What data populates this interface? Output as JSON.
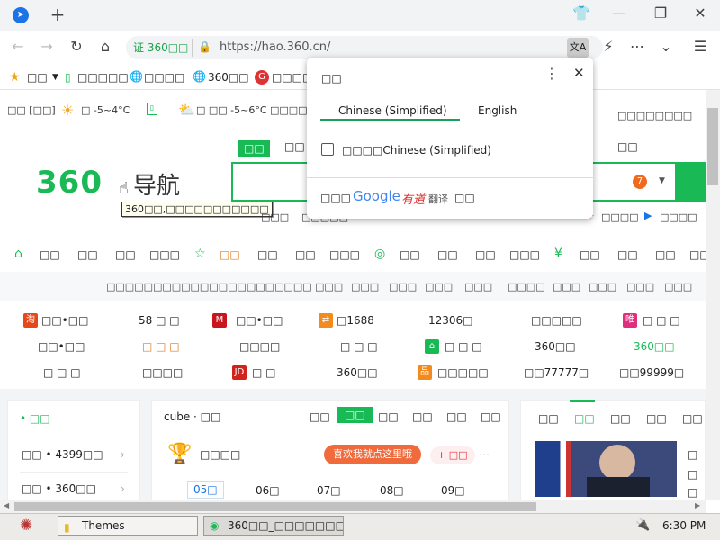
{
  "browser": {
    "tabs_icon": "compass-icon",
    "new_tab": "+",
    "url": "https://hao.360.cn/",
    "secure_chip": "证 360□□",
    "window_controls": [
      "tshirt-icon",
      "minimize-icon",
      "restore-icon",
      "close-icon"
    ],
    "toolbar_icons": [
      "translate-icon",
      "lightning-icon",
      "more-icon",
      "chevron-down-icon",
      "menu-icon"
    ]
  },
  "bookmarks": [
    {
      "icon": "star-icon",
      "label": "□□"
    },
    {
      "icon": "phone-icon",
      "label": "□□□□□"
    },
    {
      "icon": "globe-icon",
      "label": "□□□□"
    },
    {
      "icon": "globe-icon",
      "label": "360□□"
    },
    {
      "icon": "g-logo-icon",
      "label": "□□□□"
    }
  ],
  "translate_popup": {
    "title": "□□",
    "tab_source": "Chinese (Simplified)",
    "tab_target": "English",
    "checkbox_label": "□□□□Chinese (Simplified)",
    "footer_prefix": "□□□",
    "footer_brand": "Google",
    "footer_youdao": "有道",
    "footer_fanyi": "翻译",
    "footer_suffix": "□□"
  },
  "weather": {
    "city": "□□ [□□]",
    "today": "□ -5~4°C",
    "tomorrow": "□ □□ -5~6°C",
    "more": "□□□□",
    "right": "□□□□□□□□"
  },
  "logo": {
    "n360": "360",
    "dh": "导航",
    "tooltip": "360□□,□□□□□□□□□□□"
  },
  "search": {
    "tabs": [
      "□□",
      "□□",
      "□□"
    ],
    "badge": "7",
    "under_links": [
      "□□□",
      "□□□□□",
      "□□□□",
      "□□□□"
    ]
  },
  "categories": [
    {
      "icon": "home-icon",
      "items": [
        "□□",
        "□□",
        "□□",
        "□□□"
      ]
    },
    {
      "icon": "star-icon",
      "items": [
        "□□",
        "□□",
        "□□",
        "□□□"
      ]
    },
    {
      "icon": "game-icon",
      "items": [
        "□□",
        "□□",
        "□□",
        "□□□"
      ]
    },
    {
      "icon": "money-icon",
      "items": [
        "□□",
        "□□",
        "□□",
        "□□"
      ]
    }
  ],
  "sublinks": {
    "left": "□□□□□□□□□□□□□□□□□□□□□□",
    "items": [
      "□□□",
      "□□□",
      "□□□",
      "□□□",
      "□□□",
      "□□□□",
      "□□□",
      "□□□",
      "□□□",
      "□□□"
    ]
  },
  "sites": [
    [
      "□□•□□",
      "58 □ □",
      "□□•□□",
      "□1688",
      "12306□",
      "□□□□□",
      "□ □ □"
    ],
    [
      "□□•□□",
      "□ □ □",
      "□□□□",
      "□ □ □",
      "□ □ □",
      "360□□",
      "360□□"
    ],
    [
      "□ □ □",
      "□□□□",
      "□ □",
      "360□□",
      "□□□□□",
      "□□77777□",
      "□□99999□"
    ]
  ],
  "left_col": {
    "active": "□□",
    "rows": [
      "□□ • 4399□□",
      "□□ • 360□□"
    ]
  },
  "mid_col": {
    "title": "cube · □□",
    "tabs": [
      "□□",
      "□□",
      "□□",
      "□□",
      "□□",
      "□□"
    ],
    "item": "□□□□",
    "promo": "喜欢我就点这里哦",
    "add": "+ □□",
    "dates": [
      "05□",
      "06□",
      "07□",
      "08□",
      "09□"
    ]
  },
  "right_col": {
    "tabs": [
      "□□",
      "□□",
      "□□",
      "□□",
      "□□"
    ],
    "side": [
      "□",
      "□",
      "□"
    ]
  },
  "taskbar": {
    "items": [
      "Themes",
      "360□□_□□□□□□□..."
    ],
    "clock": "6:30 PM"
  }
}
